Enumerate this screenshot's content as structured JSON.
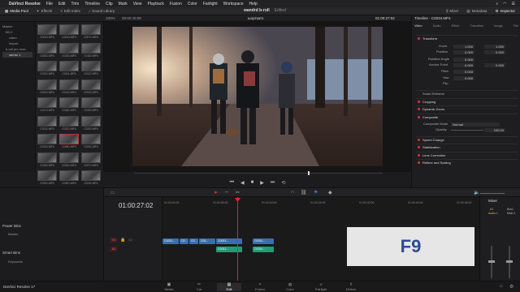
{
  "menubar": {
    "app_name": "DaVinci Resolve",
    "items": [
      "File",
      "Edit",
      "Trim",
      "Timeline",
      "Clip",
      "Mark",
      "View",
      "Playback",
      "Fusion",
      "Color",
      "Fairlight",
      "Workspace",
      "Help"
    ]
  },
  "toolbar": {
    "media_pool": "Media Pool",
    "effects": "Effects",
    "edit_index": "Edit Index",
    "sound_library": "Sound Library",
    "project_title": "wandrd b-roll",
    "edited": "Edited",
    "mixer": "Mixer",
    "metadata": "Metadata",
    "inspector": "Inspector"
  },
  "viewer": {
    "zoom": "100%",
    "timecode_left": "00:00:40:09",
    "clip_name": "шорткатs",
    "timecode_right": "01:00:27:02",
    "zoom_right": "100%"
  },
  "bins": {
    "items": [
      "Master",
      "B0-2",
      "video",
      "Import",
      "b-roll pro max",
      "чисты 1"
    ]
  },
  "media": {
    "clips": [
      "C0031.MP4",
      "C0041.MP4",
      "C0071.MP4",
      "C0051.MP4",
      "C0151.MP4",
      "C0161.MP4",
      "C0101.MP4",
      "C0111.MP4",
      "C0121.MP4",
      "C0021.MP4",
      "C0141.MP4",
      "C0131.MP4",
      "C0171.MP4",
      "C0181.MP4",
      "C0191.MP4",
      "C0211.MP4",
      "C0221.MP4",
      "C0201.MP4",
      "C0231.MP4",
      "C0281.MP4",
      "C0241.MP4",
      "C0251.MP4",
      "C0261.MP4",
      "C0271.MP4",
      "C0291.MP4",
      "C0301.MP4",
      "C0311.MP4",
      "C0321.MP4",
      "C0331.MP4",
      "C0341.MP4"
    ]
  },
  "inspector": {
    "timeline_label": "Timeline - C0034.MP4",
    "tabs": [
      "Video",
      "Audio",
      "Effect",
      "Transition",
      "Image",
      "File"
    ],
    "transform": "Transform",
    "zoom": "Zoom",
    "position": "Position",
    "rotation_angle": "Rotation Angle",
    "anchor_point": "Anchor Point",
    "pitch": "Pitch",
    "yaw": "Yaw",
    "flip": "Flip",
    "zoom_x": "1.000",
    "zoom_y": "1.000",
    "pos_x": "0.000",
    "pos_y": "0.000",
    "rot": "0.000",
    "anchor_x": "0.000",
    "anchor_y": "0.000",
    "pitch_v": "0.000",
    "yaw_v": "0.000",
    "smart_reframe": "Smart Reframe",
    "cropping": "Cropping",
    "dynamic_zoom": "Dynamic Zoom",
    "composite": "Composite",
    "composite_mode": "Composite Mode",
    "composite_mode_value": "Normal",
    "opacity": "Opacity",
    "opacity_value": "100.00",
    "speed_change": "Speed Change",
    "stabilization": "Stabilization",
    "lens_correction": "Lens Correction",
    "retime": "Retime and Scaling"
  },
  "timeline": {
    "timecode": "01:00:27:02",
    "ruler": [
      "01:00:00:00",
      "01:00:08:00",
      "01:00:16:00",
      "01:00:24:00",
      "01:00:32:00",
      "01:00:40:00",
      "01:00:48:00"
    ],
    "v1": "V1",
    "a1": "A1",
    "clip_labels": [
      "C0031...",
      "C0...",
      "C0...",
      "C00...",
      "C0031...",
      "C0031..."
    ],
    "audio_labels": [
      "C0031...",
      "C0031..."
    ]
  },
  "panels": {
    "power_bins": "Power Bins",
    "master": "Master",
    "smart_bins": "Smart Bins",
    "keywords": "Keywords"
  },
  "mixer": {
    "title": "Mixer",
    "a1": "A1",
    "bus1": "Bus1",
    "audio1": "Audio 1",
    "main": "Main 1"
  },
  "pages": [
    "Media",
    "Cut",
    "Edit",
    "Fusion",
    "Color",
    "Fairlight",
    "Deliver"
  ],
  "footer": {
    "app_version": "DaVinci Resolve 17"
  },
  "overlay": {
    "key": "F9"
  }
}
